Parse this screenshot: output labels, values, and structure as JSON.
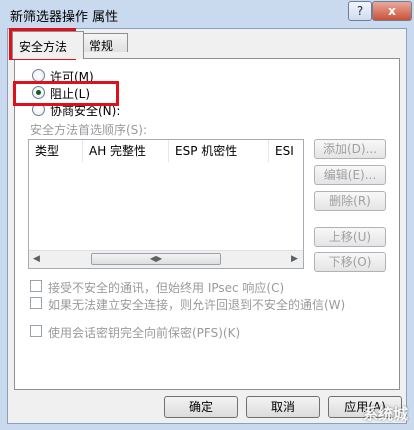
{
  "window": {
    "title": "新筛选器操作 属性",
    "help_glyph": "?",
    "close_glyph": "x"
  },
  "tabs": [
    {
      "label": "安全方法",
      "active": true
    },
    {
      "label": "常规",
      "active": false
    }
  ],
  "options": [
    {
      "label": "许可(M)",
      "checked": false
    },
    {
      "label": "阻止(L)",
      "checked": true
    },
    {
      "label": "协商安全(N):",
      "checked": false
    }
  ],
  "methods_label": "安全方法首选顺序(S):",
  "table": {
    "columns": [
      "类型",
      "AH 完整性",
      "ESP 机密性",
      "ESI"
    ]
  },
  "side_buttons": [
    "添加(D)...",
    "编辑(E)...",
    "删除(R)",
    "上移(U)",
    "下移(O)"
  ],
  "checkboxes": [
    {
      "label": "接受不安全的通讯，但始终用 IPsec 响应(C)",
      "checked": false
    },
    {
      "label": "如果无法建立安全连接，则允许回退到不安全的通信(W)",
      "checked": false
    },
    {
      "label": "使用会话密钥完全向前保密(PFS)(K)",
      "checked": false
    }
  ],
  "footer": {
    "ok": "确定",
    "cancel": "取消",
    "apply": "应用(A)"
  },
  "watermark": "系统城",
  "colors": {
    "highlight": "#e0101a",
    "selected_radio": "#1a5a1a"
  }
}
